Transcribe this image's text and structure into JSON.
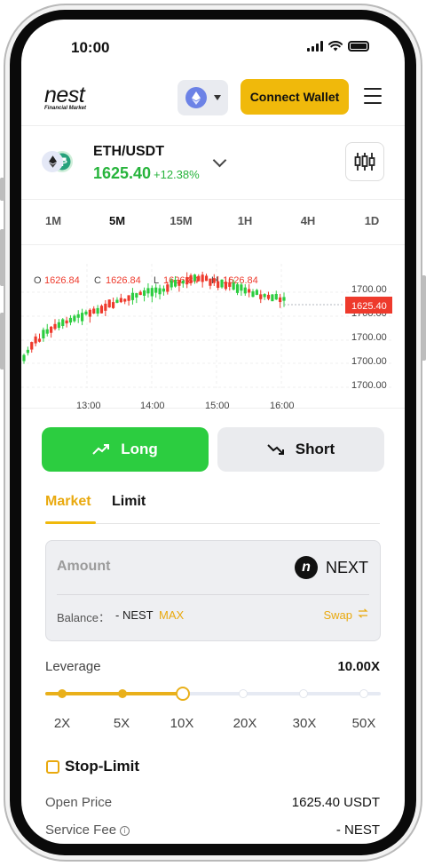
{
  "status_bar": {
    "time": "10:00"
  },
  "header": {
    "logo_word": "nest",
    "logo_sub": "Financial Market",
    "network_icon": "ethereum-icon",
    "connect_label": "Connect Wallet",
    "menu_icon": "hamburger-menu-icon"
  },
  "pair": {
    "name": "ETH/USDT",
    "price": "1625.40",
    "change": "+12.38%",
    "price_color": "#27b43c"
  },
  "timeframes": [
    {
      "label": "1M",
      "active": false
    },
    {
      "label": "5M",
      "active": true
    },
    {
      "label": "15M",
      "active": false
    },
    {
      "label": "1H",
      "active": false
    },
    {
      "label": "4H",
      "active": false
    },
    {
      "label": "1D",
      "active": false
    }
  ],
  "chart": {
    "ohlc": [
      {
        "key": "O",
        "value": "1626.84"
      },
      {
        "key": "C",
        "value": "1626.84"
      },
      {
        "key": "L",
        "value": "1626.84"
      },
      {
        "key": "H",
        "value": "1626.84"
      }
    ],
    "y_ticks": [
      "1700.00",
      "1700.00",
      "1700.00",
      "1700.00",
      "1700.00"
    ],
    "x_ticks": [
      "13:00",
      "14:00",
      "15:00",
      "16:00"
    ],
    "current_price_tag": "1625.40",
    "up_color": "#2ccd40",
    "down_color": "#ee3a2c"
  },
  "trade": {
    "long_label": "Long",
    "short_label": "Short",
    "long_color": "#2ccd40",
    "tabs": {
      "market": "Market",
      "limit": "Limit"
    },
    "amount_placeholder": "Amount",
    "token": "NEXT",
    "balance_label": "Balance：",
    "balance_value": "- NEST",
    "max_label": "MAX",
    "swap_label": "Swap",
    "accent_color": "#f0b90b"
  },
  "leverage": {
    "label": "Leverage",
    "value": "10.00X",
    "options": [
      "2X",
      "5X",
      "10X",
      "20X",
      "30X",
      "50X"
    ],
    "selected_index": 2
  },
  "stop_limit": {
    "label": "Stop-Limit",
    "checked": false
  },
  "info": {
    "open_price_label": "Open Price",
    "open_price_value": "1625.40 USDT",
    "service_fee_label": "Service Fee",
    "service_fee_value": "- NEST"
  }
}
